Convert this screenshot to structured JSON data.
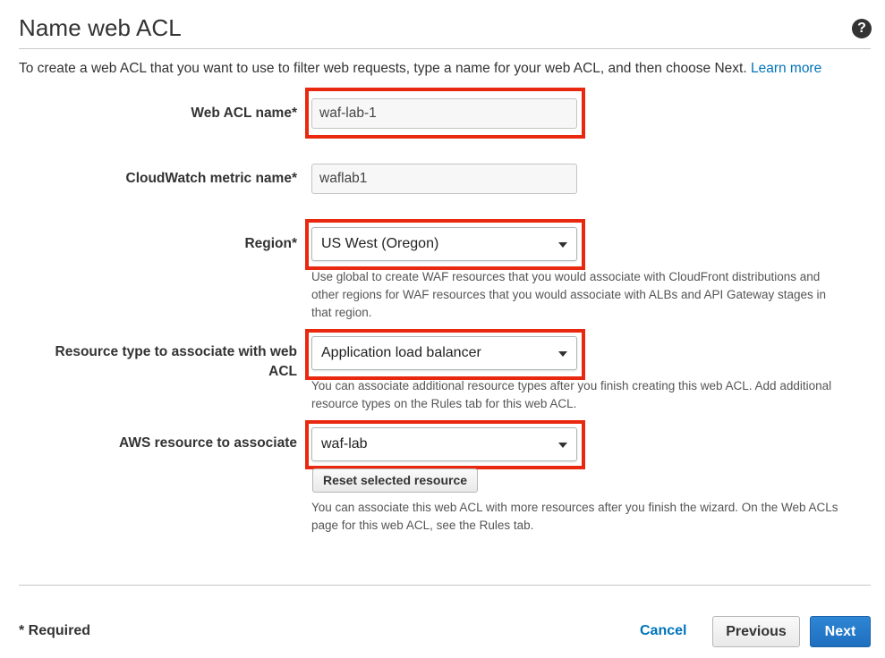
{
  "page": {
    "title": "Name web ACL",
    "intro_text": "To create a web ACL that you want to use to filter web requests, type a name for your web ACL, and then choose Next.",
    "learn_more": "Learn more"
  },
  "form": {
    "web_acl_name": {
      "label": "Web ACL name*",
      "value": "waf-lab-1"
    },
    "cloudwatch_metric": {
      "label": "CloudWatch metric name*",
      "value": "waflab1"
    },
    "region": {
      "label": "Region*",
      "value": "US West (Oregon)",
      "hint_line1": "Use global to create WAF resources that you would associate with CloudFront distributions and",
      "hint_line2": "other regions for WAF resources that you would associate with ALBs and API Gateway stages in",
      "hint_line3": "that region."
    },
    "resource_type": {
      "label_line1": "Resource type to associate with web",
      "label_line2": "ACL",
      "value": "Application load balancer",
      "hint_line1": "You can associate additional resource types after you finish creating this web ACL. Add additional",
      "hint_line2": "resource types on the Rules tab for this web ACL."
    },
    "aws_resource": {
      "label": "AWS resource to associate",
      "value": "waf-lab",
      "reset_label": "Reset selected resource",
      "hint_line1": "You can associate this web ACL with more resources after you finish the wizard. On the Web ACLs",
      "hint_line2": "page for this web ACL, see the Rules tab."
    }
  },
  "footer": {
    "required_note": "* Required",
    "cancel_label": "Cancel",
    "previous_label": "Previous",
    "next_label": "Next"
  },
  "icons": {
    "help": "help-circle-icon",
    "dropdown": "caret-down-icon"
  },
  "colors": {
    "highlight": "#e8290f",
    "link": "#0073bb",
    "primary_button": "#1f6fbf"
  }
}
